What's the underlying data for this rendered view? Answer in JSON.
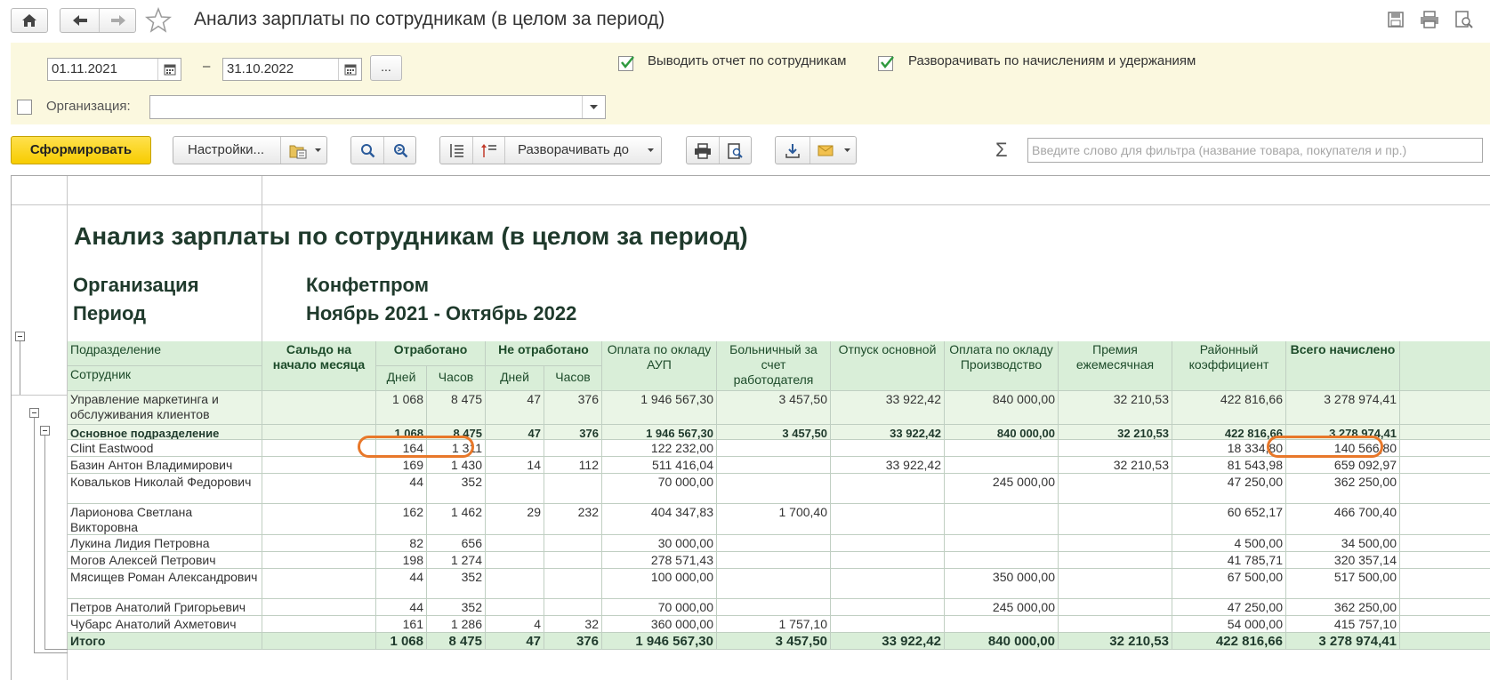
{
  "window": {
    "title": "Анализ зарплаты по сотрудникам (в целом за период)"
  },
  "titlebar_icons": [
    "home-icon",
    "arrow-left-icon",
    "arrow-right-icon",
    "star-icon",
    "save-icon",
    "print-icon",
    "preview-icon"
  ],
  "params": {
    "date_from": "01.11.2021",
    "date_to": "31.10.2022",
    "dash": "–",
    "more_label": "...",
    "show_by_employees": {
      "label": "Выводить отчет по сотрудникам",
      "checked": true
    },
    "expand_by_accruals": {
      "label": "Разворачивать по начислениям и удержаниям",
      "checked": true
    },
    "organization": {
      "label": "Организация:",
      "checked": false,
      "value": ""
    }
  },
  "toolbar": {
    "generate_label": "Сформировать",
    "settings_label": "Настройки...",
    "expand_to_label": "Разворачивать до",
    "sigma": "Σ",
    "filter_placeholder": "Введите слово для фильтра (название товара, покупателя и пр.)"
  },
  "report": {
    "title": "Анализ зарплаты по сотрудникам (в целом за период)",
    "org_key": "Организация",
    "org_value": "Конфетпром",
    "period_key": "Период",
    "period_value": "Ноябрь 2021 - Октябрь 2022",
    "headers": {
      "dept": "Подразделение",
      "employee": "Сотрудник",
      "saldo": "Сальдо на начало месяца",
      "worked": "Отработано",
      "not_worked": "Не отработано",
      "days": "Дней",
      "hours": "Часов",
      "aup": "Оплата по окладу АУП",
      "sick": "Больничный за счет работодателя",
      "vacation": "Отпуск основной",
      "production": "Оплата по окладу Производство",
      "bonus": "Премия ежемесячная",
      "regional": "Районный коэффициент",
      "total": "Всего начислено"
    },
    "rows": [
      {
        "kind": "lvl1",
        "name": "Управление маркетинга и обслуживания клиентов",
        "saldo": "",
        "wd": "1 068",
        "wh": "8 475",
        "nd": "47",
        "nh": "376",
        "aup": "1 946 567,30",
        "sick": "3 457,50",
        "vac": "33 922,42",
        "prod": "840 000,00",
        "bonus": "32 210,53",
        "reg": "422 816,66",
        "total": "3 278 974,41"
      },
      {
        "kind": "lvl2",
        "name": "Основное подразделение",
        "saldo": "",
        "wd": "1 068",
        "wh": "8 475",
        "nd": "47",
        "nh": "376",
        "aup": "1 946 567,30",
        "sick": "3 457,50",
        "vac": "33 922,42",
        "prod": "840 000,00",
        "bonus": "32 210,53",
        "reg": "422 816,66",
        "total": "3 278 974,41"
      },
      {
        "kind": "emp",
        "name": "Clint Eastwood",
        "saldo": "",
        "wd": "164",
        "wh": "1 311",
        "nd": "",
        "nh": "",
        "aup": "122 232,00",
        "sick": "",
        "vac": "",
        "prod": "",
        "bonus": "",
        "reg": "18 334,80",
        "total": "140 566,80"
      },
      {
        "kind": "emp",
        "name": "Базин Антон Владимирович",
        "saldo": "",
        "wd": "169",
        "wh": "1 430",
        "nd": "14",
        "nh": "112",
        "aup": "511 416,04",
        "sick": "",
        "vac": "33 922,42",
        "prod": "",
        "bonus": "32 210,53",
        "reg": "81 543,98",
        "total": "659 092,97"
      },
      {
        "kind": "emp",
        "name": "Ковальков Николай Федорович",
        "saldo": "",
        "wd": "44",
        "wh": "352",
        "nd": "",
        "nh": "",
        "aup": "70 000,00",
        "sick": "",
        "vac": "",
        "prod": "245 000,00",
        "bonus": "",
        "reg": "47 250,00",
        "total": "362 250,00"
      },
      {
        "kind": "emp",
        "name": "Ларионова Светлана Викторовна",
        "saldo": "",
        "wd": "162",
        "wh": "1 462",
        "nd": "29",
        "nh": "232",
        "aup": "404 347,83",
        "sick": "1 700,40",
        "vac": "",
        "prod": "",
        "bonus": "",
        "reg": "60 652,17",
        "total": "466 700,40"
      },
      {
        "kind": "emp",
        "name": "Лукина Лидия Петровна",
        "saldo": "",
        "wd": "82",
        "wh": "656",
        "nd": "",
        "nh": "",
        "aup": "30 000,00",
        "sick": "",
        "vac": "",
        "prod": "",
        "bonus": "",
        "reg": "4 500,00",
        "total": "34 500,00"
      },
      {
        "kind": "emp",
        "name": "Могов Алексей Петрович",
        "saldo": "",
        "wd": "198",
        "wh": "1 274",
        "nd": "",
        "nh": "",
        "aup": "278 571,43",
        "sick": "",
        "vac": "",
        "prod": "",
        "bonus": "",
        "reg": "41 785,71",
        "total": "320 357,14"
      },
      {
        "kind": "emp",
        "name": "Мясищев Роман Александрович",
        "saldo": "",
        "wd": "44",
        "wh": "352",
        "nd": "",
        "nh": "",
        "aup": "100 000,00",
        "sick": "",
        "vac": "",
        "prod": "350 000,00",
        "bonus": "",
        "reg": "67 500,00",
        "total": "517 500,00"
      },
      {
        "kind": "emp",
        "name": "Петров Анатолий Григорьевич",
        "saldo": "",
        "wd": "44",
        "wh": "352",
        "nd": "",
        "nh": "",
        "aup": "70 000,00",
        "sick": "",
        "vac": "",
        "prod": "245 000,00",
        "bonus": "",
        "reg": "47 250,00",
        "total": "362 250,00"
      },
      {
        "kind": "emp",
        "name": "Чубарс Анатолий Ахметович",
        "saldo": "",
        "wd": "161",
        "wh": "1 286",
        "nd": "4",
        "nh": "32",
        "aup": "360 000,00",
        "sick": "1 757,10",
        "vac": "",
        "prod": "",
        "bonus": "",
        "reg": "54 000,00",
        "total": "415 757,10"
      },
      {
        "kind": "tot",
        "name": "Итого",
        "saldo": "",
        "wd": "1 068",
        "wh": "8 475",
        "nd": "47",
        "nh": "376",
        "aup": "1 946 567,30",
        "sick": "3 457,50",
        "vac": "33 922,42",
        "prod": "840 000,00",
        "bonus": "32 210,53",
        "reg": "422 816,66",
        "total": "3 278 974,41"
      }
    ]
  },
  "colors": {
    "accent_yellow": "#f7cc00",
    "param_panel": "#fbf8df",
    "header_green": "#d9eed8",
    "highlight_ring": "#e8782a"
  }
}
